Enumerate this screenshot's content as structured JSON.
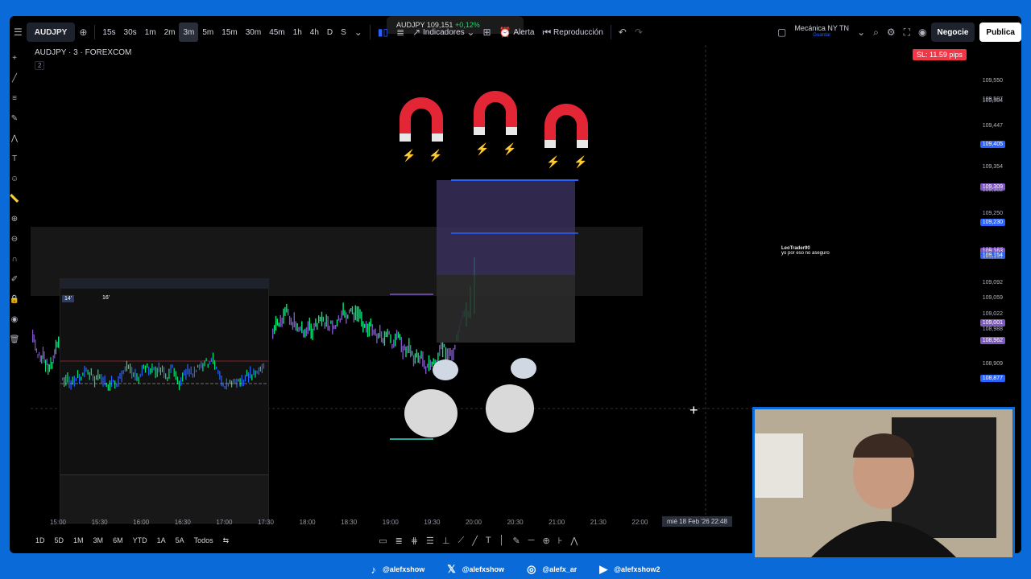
{
  "browser": {
    "tab_title": "AUDJPY",
    "tab_price": "109,151",
    "tab_change": "+0,12%"
  },
  "toolbar": {
    "symbol": "AUDJPY",
    "timeframes": [
      "15s",
      "30s",
      "1m",
      "2m",
      "3m",
      "5m",
      "15m",
      "30m",
      "45m",
      "1h",
      "4h",
      "D",
      "S"
    ],
    "active_timeframe": "3m",
    "indicators_label": "Indicadores",
    "alert_label": "Alerta",
    "replay_label": "Reproducción",
    "layout_name": "Mecánica NY TN",
    "layout_sub": "Guardar",
    "trade_label": "Negocie",
    "publish_label": "Publica"
  },
  "chart": {
    "symbol_title": "AUDJPY · 3 · FOREXCOM",
    "legend_count": "2",
    "sl_badge": "SL: 11.59 pips",
    "accent_green": "#26a69a",
    "accent_red": "#f23645",
    "accent_purple": "#7e57c2"
  },
  "chart_data": {
    "type": "line",
    "title": "",
    "x_labels": [
      "15:00",
      "15:30",
      "16:00",
      "16:30",
      "17:00",
      "17:30",
      "18:00",
      "18:30",
      "19:00",
      "19:30",
      "20:00",
      "20:30",
      "21:00",
      "21:30",
      "22:00"
    ],
    "ylim": [
      108.8,
      109.6
    ],
    "price_labels": [
      {
        "value": "109,550",
        "kind": "plain"
      },
      {
        "value": "109,507",
        "kind": "plain"
      },
      {
        "value": "109,504",
        "kind": "plain"
      },
      {
        "value": "109,447",
        "kind": "plain"
      },
      {
        "value": "109,405",
        "kind": "blue"
      },
      {
        "value": "109,354",
        "kind": "plain"
      },
      {
        "value": "109,309",
        "kind": "purple"
      },
      {
        "value": "109,302",
        "kind": "plain"
      },
      {
        "value": "109,250",
        "kind": "plain"
      },
      {
        "value": "109,230",
        "kind": "blue"
      },
      {
        "value": "109,167",
        "kind": "plain"
      },
      {
        "value": "109,163",
        "kind": "purple"
      },
      {
        "value": "109,154",
        "kind": "blue"
      },
      {
        "value": "109,151",
        "kind": "plain"
      },
      {
        "value": "109,092",
        "kind": "plain"
      },
      {
        "value": "109,059",
        "kind": "plain"
      },
      {
        "value": "109,022",
        "kind": "plain"
      },
      {
        "value": "109,001",
        "kind": "purple"
      },
      {
        "value": "108,988",
        "kind": "plain"
      },
      {
        "value": "108,962",
        "kind": "purple"
      },
      {
        "value": "108,909",
        "kind": "plain"
      },
      {
        "value": "108,877",
        "kind": "blue"
      }
    ],
    "cursor_time": "mié 18 Feb '26   22:48",
    "position_box": {
      "entry": 109.151,
      "target": 109.405,
      "stop": 108.877
    }
  },
  "embedded_chart": {
    "tag1": "14'",
    "tag2": "16'"
  },
  "chat": {
    "user": "LeoTrader90",
    "message": "yo por eso no aseguro"
  },
  "bottom_bar": {
    "ranges": [
      "1D",
      "5D",
      "1M",
      "3M",
      "6M",
      "YTD",
      "1A",
      "5A",
      "Todos"
    ]
  },
  "social": [
    {
      "icon": "tiktok-icon",
      "glyph": "♪",
      "handle": "@alefxshow"
    },
    {
      "icon": "x-icon",
      "glyph": "𝕏",
      "handle": "@alefxshow"
    },
    {
      "icon": "instagram-icon",
      "glyph": "◎",
      "handle": "@alefx_ar"
    },
    {
      "icon": "youtube-icon",
      "glyph": "▶",
      "handle": "@alefxshow2"
    }
  ]
}
